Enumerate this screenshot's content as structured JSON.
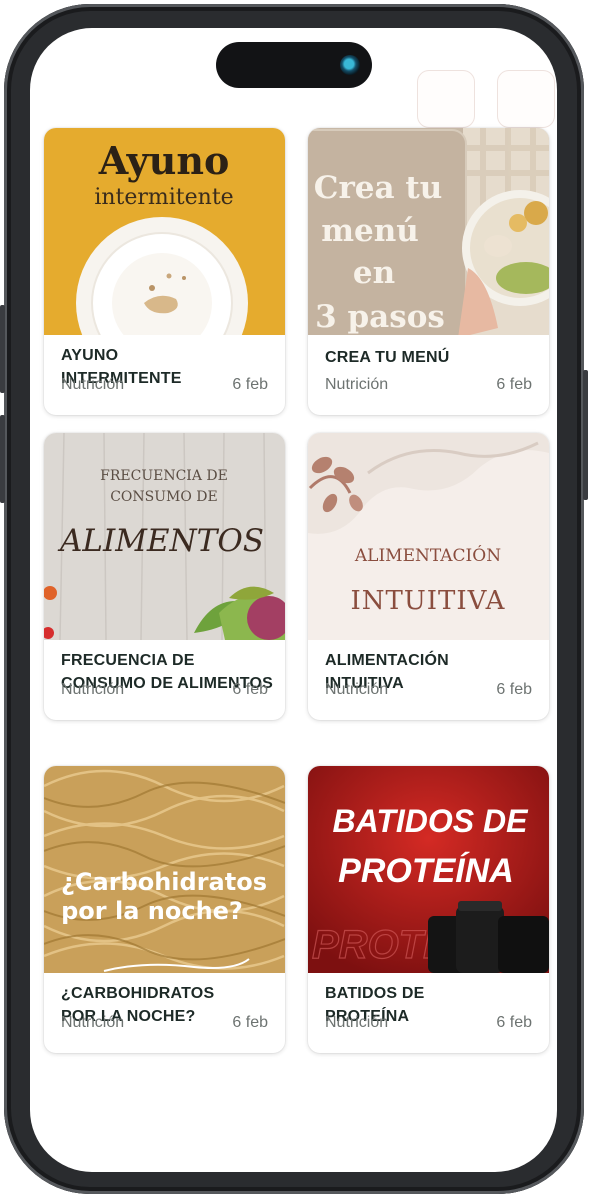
{
  "cards": [
    {
      "title": "AYUNO\nINTERMITENTE",
      "category": "Nutrición",
      "date": "6 feb",
      "image_text": [
        "Ayuno",
        "intermitente"
      ],
      "image_bg": "#e5ab2e"
    },
    {
      "title": "CREA TU MENÚ",
      "category": "Nutrición",
      "date": "6 feb",
      "image_text": [
        "Crea tu",
        "menú",
        "en",
        "3 pasos"
      ],
      "image_bg": "#c7b8a6"
    },
    {
      "title": "FRECUENCIA DE CONSUMO DE ALIMENTOS",
      "category": "Nutrición",
      "date": "6 feb",
      "image_text": [
        "FRECUENCIA DE",
        "CONSUMO DE",
        "ALIMENTOS"
      ],
      "image_bg": "#dcd8d3"
    },
    {
      "title": "ALIMENTACIÓN\nINTUITIVA",
      "category": "Nutrición",
      "date": "6 feb",
      "image_text": [
        "ALIMENTACIÓN",
        "INTUITIVA"
      ],
      "image_bg": "#f5eeea"
    },
    {
      "title": "¿CARBOHIDRATOS\nPOR LA NOCHE?",
      "category": "Nutrición",
      "date": "6 feb",
      "image_text": [
        "¿Carbohidratos",
        "por la noche?"
      ],
      "image_bg": "#c9a05a"
    },
    {
      "title": "BATIDOS DE\nPROTEÍNA",
      "category": "Nutrición",
      "date": "6 feb",
      "image_text": [
        "BATIDOS DE",
        "PROTEÍNA",
        "PROTE"
      ],
      "image_bg": "#b01c1c"
    }
  ],
  "colors": {
    "title_text": "#1d2a27",
    "meta_text": "#6d7371",
    "card_bg": "#ffffff"
  }
}
